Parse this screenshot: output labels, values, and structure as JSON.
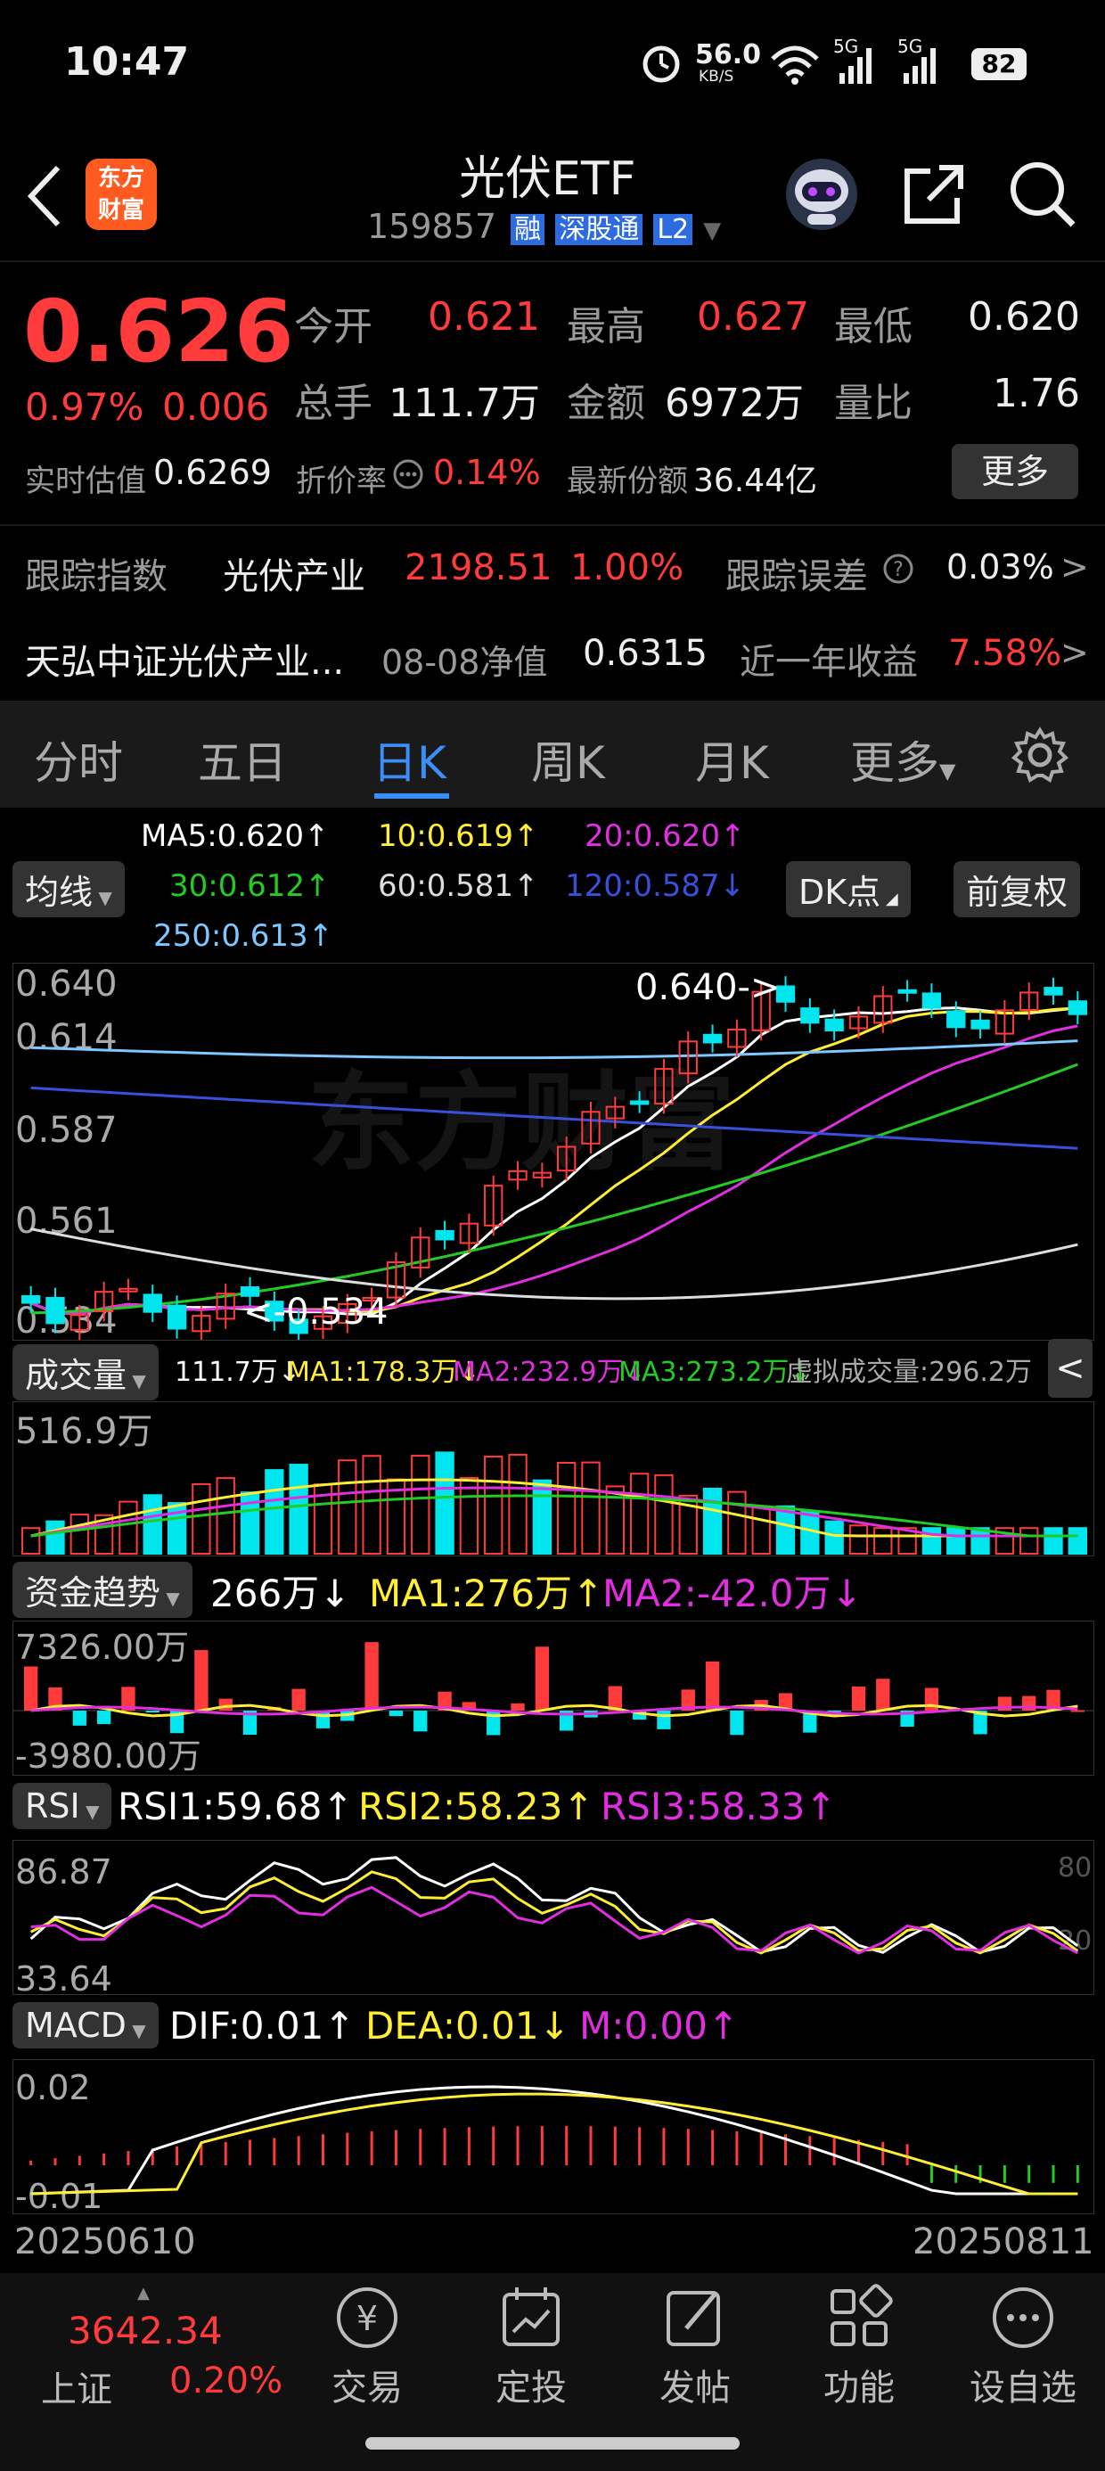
{
  "status": {
    "time": "10:47",
    "speed": "56.0",
    "speed_unit": "KB/S",
    "net1": "5G",
    "net2": "5G",
    "battery": "82"
  },
  "header": {
    "title": "光伏ETF",
    "code": "159857",
    "tag_rong": "融",
    "tag_sgt": "深股通",
    "tag_l2": "L2",
    "logo_line1": "东方",
    "logo_line2": "财富"
  },
  "quote": {
    "price": "0.626",
    "change_pct": "0.97%",
    "change": "0.006",
    "open_label": "今开",
    "open": "0.621",
    "high_label": "最高",
    "high": "0.627",
    "low_label": "最低",
    "low": "0.620",
    "vol_label": "总手",
    "vol": "111.7万",
    "amount_label": "金额",
    "amount": "6972万",
    "ratio_label": "量比",
    "ratio": "1.76",
    "est_label": "实时估值",
    "est": "0.6269",
    "disc_label": "折价率",
    "disc": "0.14%",
    "share_label": "最新份额",
    "share": "36.44亿",
    "more_btn": "更多"
  },
  "tracking": {
    "label": "跟踪指数",
    "index": "光伏产业",
    "index_value": "2198.51",
    "index_pct": "1.00%",
    "err_label": "跟踪误差",
    "err": "0.03%"
  },
  "fund": {
    "name": "天弘中证光伏产业...",
    "nav_date": "08-08净值",
    "nav": "0.6315",
    "ret_label": "近一年收益",
    "ret": "7.58%"
  },
  "tabs": [
    "分时",
    "五日",
    "日K",
    "周K",
    "月K",
    "更多"
  ],
  "active_tab": 2,
  "ma": {
    "ma5": "MA5:0.620↑",
    "ma10": "10:0.619↑",
    "ma20": "20:0.620↑",
    "ma30": "30:0.612↑",
    "ma60": "60:0.581↑",
    "ma120": "120:0.587↓",
    "ma250": "250:0.613↑",
    "select": "均线",
    "dk": "DK点",
    "fq": "前复权"
  },
  "kline": {
    "y_labels": [
      "0.640",
      "0.614",
      "0.587",
      "0.561",
      "0.534"
    ],
    "hi_mark": "0.640->",
    "lo_mark": "<-0.534",
    "watermark": "东方财富"
  },
  "volume": {
    "select": "成交量",
    "cur": "111.7万↓",
    "ma1": "MA1:178.3万↓",
    "ma2": "MA2:232.9万↓",
    "ma3": "MA3:273.2万↓",
    "virt": "虚拟成交量:296.2万",
    "y_top": "516.9万"
  },
  "fundflow": {
    "select": "资金趋势",
    "cur": "266万↓",
    "ma1": "MA1:276万↑",
    "ma2": "MA2:-42.0万↓",
    "y_top": "7326.00万",
    "y_bot": "-3980.00万"
  },
  "rsi": {
    "select": "RSI",
    "rsi1": "RSI1:59.68↑",
    "rsi2": "RSI2:58.23↑",
    "rsi3": "RSI3:58.33↑",
    "y_top": "86.87",
    "y_bot": "33.64",
    "lvl80": "80",
    "lvl20": "20"
  },
  "macd": {
    "select": "MACD",
    "dif": "DIF:0.01↑",
    "dea": "DEA:0.01↓",
    "m": "M:0.00↑",
    "y_top": "0.02",
    "y_bot": "-0.01"
  },
  "dates": {
    "start": "20250610",
    "end": "20250811"
  },
  "bottom": {
    "index_value": "3642.34",
    "index_name": "上证",
    "index_pct": "0.20%",
    "nav": [
      "交易",
      "定投",
      "发帖",
      "功能",
      "设自选"
    ]
  },
  "colors": {
    "up": "#ff3b3b",
    "down": "#00e5ee",
    "bg": "#000000",
    "ma5": "#ffffff",
    "ma10": "#ffee33",
    "ma20": "#e02ee0",
    "ma30": "#22cc22",
    "ma60": "#dddddd",
    "ma120": "#3a50dd",
    "ma250": "#7fc8ff"
  },
  "icons": [
    "back-arrow-icon",
    "robot-icon",
    "share-icon",
    "search-icon",
    "settings-gear-icon",
    "help-circle-icon",
    "collapse-arrow-icon"
  ]
}
